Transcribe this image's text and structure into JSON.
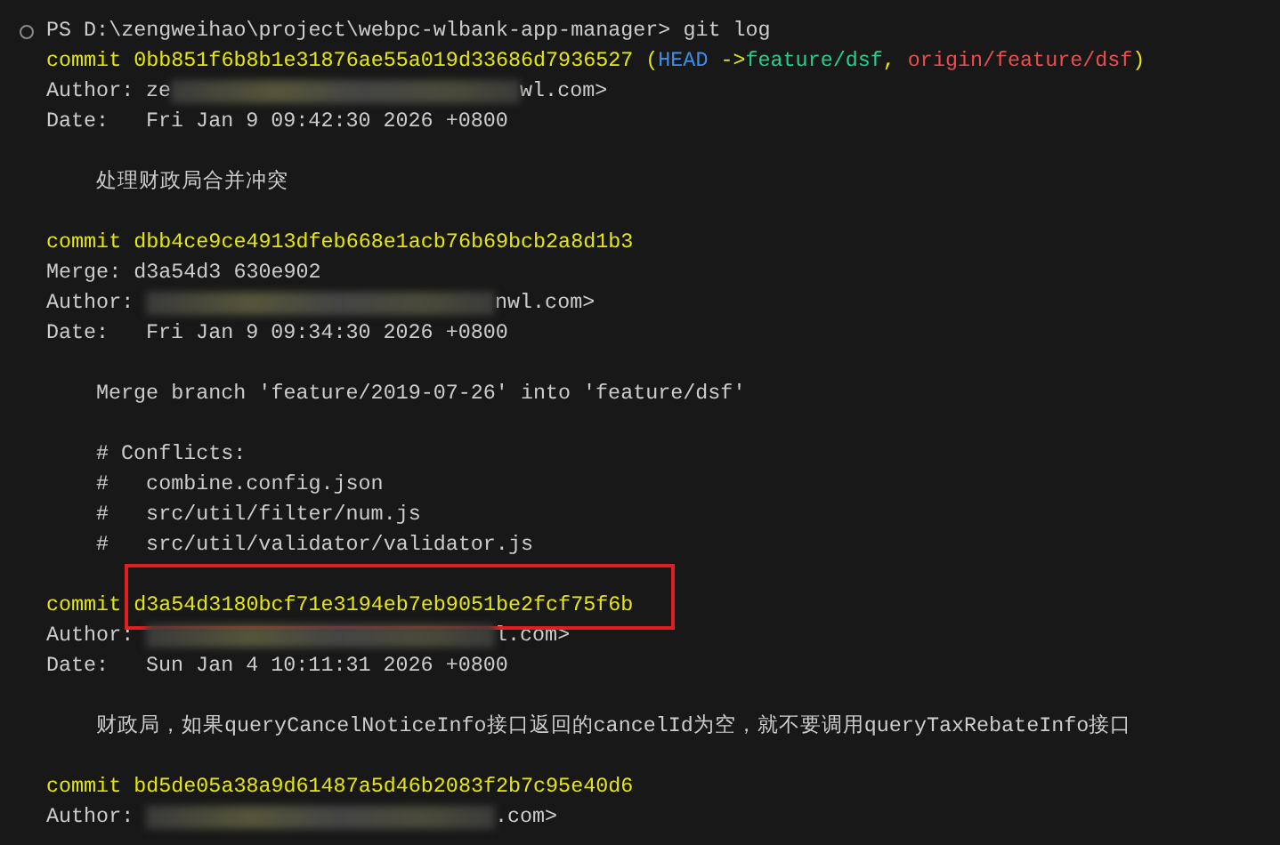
{
  "prompt": {
    "path": "PS D:\\zengweihao\\project\\webpc-wlbank-app-manager>",
    "command": "git log"
  },
  "commits": [
    {
      "label": "commit",
      "hash": "0bb851f6b8b1e31876ae55a019d33686d7936527",
      "highlighted": false,
      "refs": [
        {
          "text": "(",
          "kind": "punct"
        },
        {
          "text": "HEAD",
          "kind": "head"
        },
        {
          "text": "->",
          "kind": "punct"
        },
        {
          "text": "feature/dsf",
          "kind": "local"
        },
        {
          "text": ",",
          "kind": "punct"
        },
        {
          "text": "origin/feature/dsf",
          "kind": "remote"
        },
        {
          "text": ")",
          "kind": "punct"
        }
      ],
      "author_label": "Author:",
      "author_start": "ze",
      "author_end": "wl.com>",
      "date_label": "Date:",
      "date": "Fri Jan 9 09:42:30 2026 +0800",
      "message": [
        [
          "处理财政局合并冲突"
        ]
      ]
    },
    {
      "label": "commit",
      "hash": "dbb4ce9ce4913dfeb668e1acb76b69bcb2a8d1b3",
      "highlighted": false,
      "merge": "Merge: d3a54d3 630e902",
      "author_label": "Author:",
      "author_end": "nwl.com>",
      "date_label": "Date:",
      "date": "Fri Jan 9 09:34:30 2026 +0800",
      "message": [
        [
          "Merge branch 'feature/2019-07-26' into 'feature/dsf'"
        ],
        [
          "# Conflicts:",
          "#   combine.config.json",
          "#   src/util/filter/num.js",
          "#   src/util/validator/validator.js"
        ]
      ]
    },
    {
      "label": "commit",
      "hash": "d3a54d3180bcf71e3194eb7eb9051be2fcf75f6b",
      "highlighted": true,
      "author_label": "Author:",
      "author_end": "l.com>",
      "date_label": "Date:",
      "date": "Sun Jan 4 10:11:31 2026 +0800",
      "message": [
        [
          "财政局，如果queryCancelNoticeInfo接口返回的cancelId为空，就不要调用queryTaxRebateInfo接口"
        ]
      ]
    },
    {
      "label": "commit",
      "hash": "bd5de05a38a9d61487a5d46b2083f2b7c95e40d6",
      "highlighted": false,
      "author_label": "Author:",
      "author_end": ".com>"
    }
  ]
}
